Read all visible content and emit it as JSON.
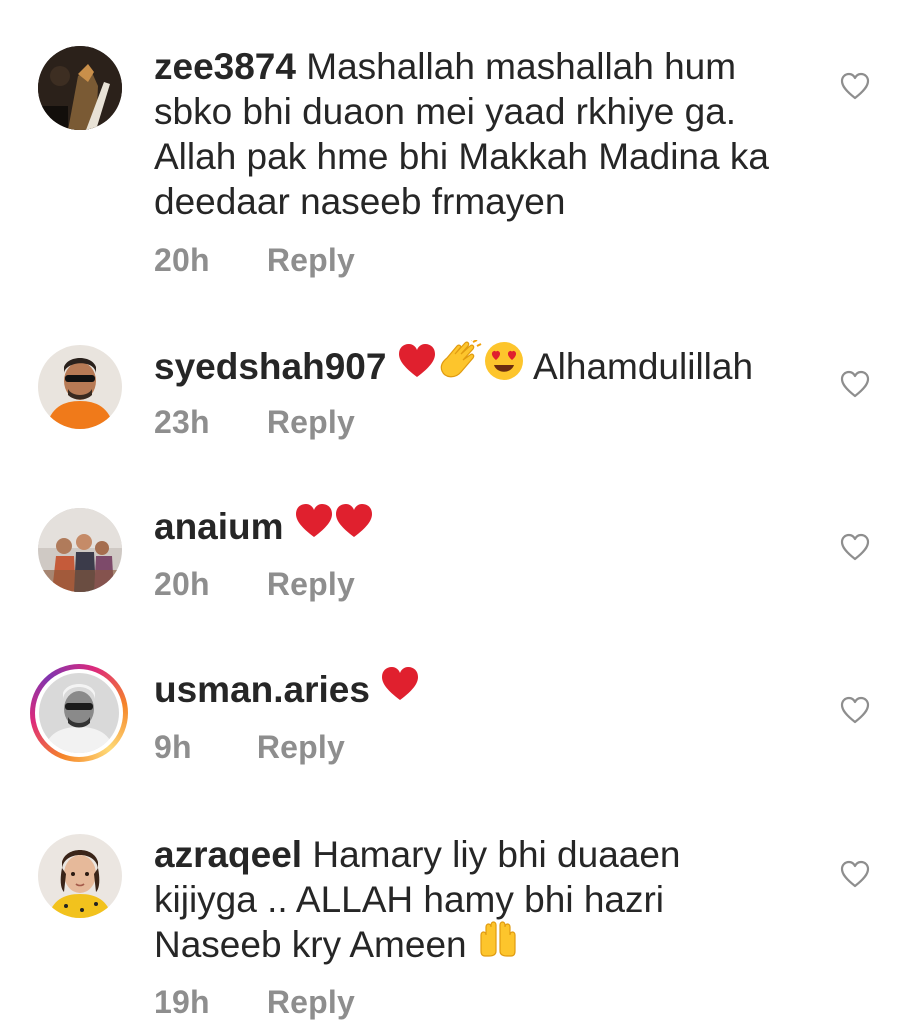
{
  "comments": [
    {
      "username": "zee3874",
      "text": "Mashallah mashallah hum sbko bhi duaon mei yaad rkhiye ga. Allah pak hme bhi Makkah Madina ka deedaar naseeb frmayen",
      "time": "20h",
      "reply": "Reply",
      "emojis": []
    },
    {
      "username": "syedshah907",
      "text": "Alhamdulillah",
      "time": "23h",
      "reply": "Reply",
      "emojis": [
        "red-heart",
        "clapping-hands",
        "heart-eyes-face"
      ]
    },
    {
      "username": "anaium",
      "text": "",
      "time": "20h",
      "reply": "Reply",
      "emojis": [
        "red-heart",
        "red-heart"
      ]
    },
    {
      "username": "usman.aries",
      "text": "",
      "time": "9h",
      "reply": "Reply",
      "emojis": [
        "red-heart"
      ]
    },
    {
      "username": "azraqeel",
      "text": "Hamary liy bhi duaaen kijiyga .. ALLAH hamy bhi hazri Naseeb kry Ameen",
      "time": "19h",
      "reply": "Reply",
      "emojis": [
        "open-hands"
      ]
    }
  ],
  "colors": {
    "text": "#262626",
    "meta": "#8e8e8e",
    "heart_red": "#e0202e",
    "emoji_yellow": "#fdc52c"
  },
  "icons": {
    "like": "heart-outline-icon"
  }
}
